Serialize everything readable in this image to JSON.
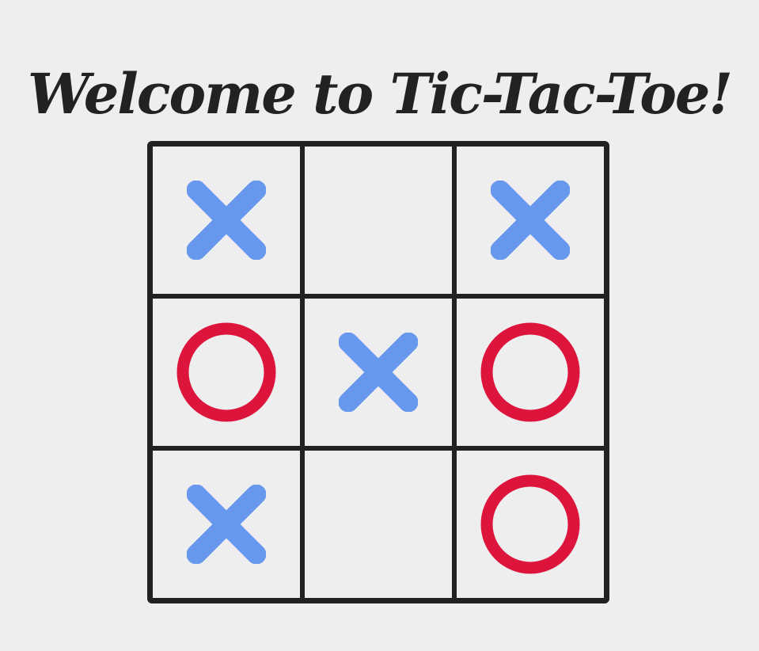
{
  "title": "Welcome to Tic-Tac-Toe!",
  "colors": {
    "background": "#eeeeee",
    "grid": "#222222",
    "x": "#6699ee",
    "o": "#dd143c"
  },
  "board": [
    [
      "X",
      "",
      "X"
    ],
    [
      "O",
      "X",
      "O"
    ],
    [
      "X",
      "",
      "O"
    ]
  ]
}
